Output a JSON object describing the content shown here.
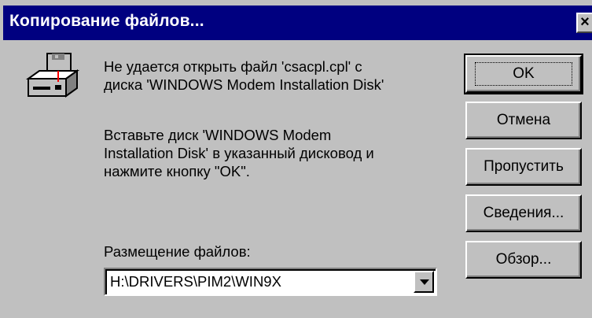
{
  "dialog": {
    "title": "Копирование файлов...",
    "close_glyph": "×",
    "icon": "floppy-drive-icon"
  },
  "message": {
    "line1": "Не удается открыть файл 'csacpl.cpl' с",
    "line2": "диска 'WINDOWS Modem Installation Disk'",
    "line3": "Вставьте диск 'WINDOWS Modem",
    "line4": "Installation Disk' в указанный дисковод и",
    "line5": "нажмите кнопку \"OK\"."
  },
  "location": {
    "label": "Размещение файлов:",
    "value": "H:\\DRIVERS\\PIM2\\WIN9X"
  },
  "buttons": {
    "ok": "OK",
    "cancel": "Отмена",
    "skip": "Пропустить",
    "details": "Сведения...",
    "browse": "Обзор..."
  },
  "colors": {
    "titlebar": "#000080",
    "face": "#c0c0c0"
  }
}
